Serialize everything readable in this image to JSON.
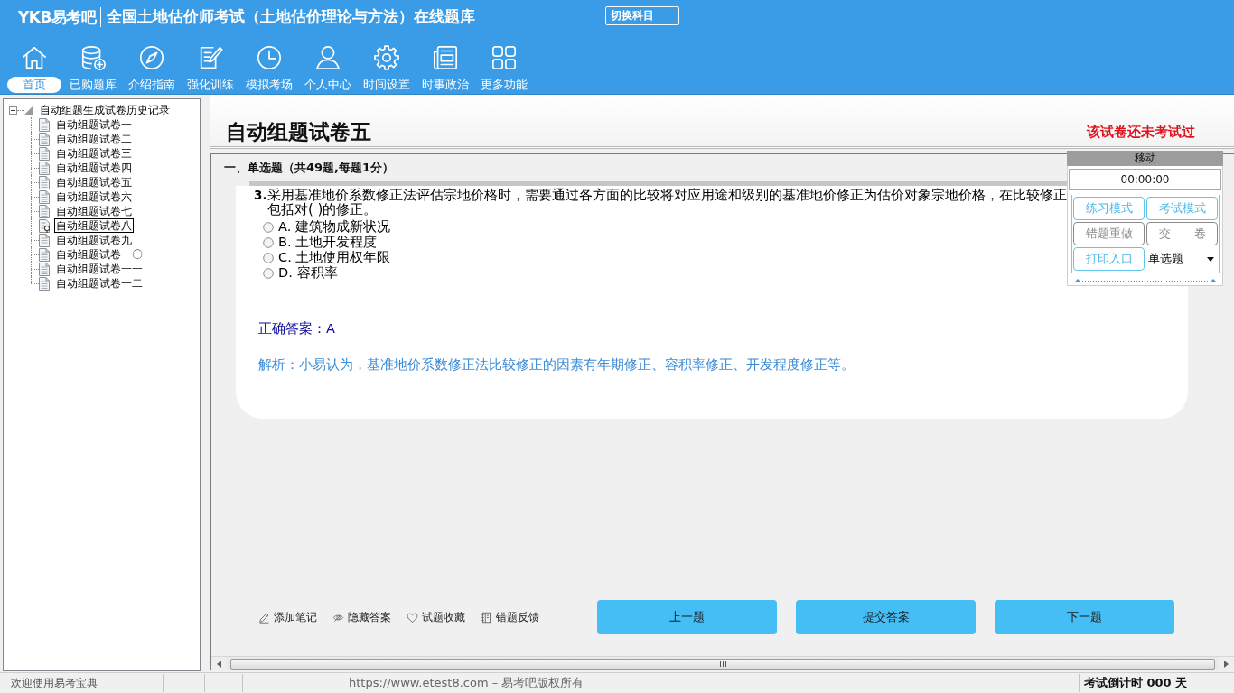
{
  "header": {
    "logo": "YKB易考吧",
    "title": "全国土地估价师考试（土地估价理论与方法）在线题库",
    "switch_button": "切换科目"
  },
  "toolbar": [
    {
      "label": "首页",
      "selected": true
    },
    {
      "label": "已购题库",
      "selected": false
    },
    {
      "label": "介绍指南",
      "selected": false
    },
    {
      "label": "强化训练",
      "selected": false
    },
    {
      "label": "模拟考场",
      "selected": false
    },
    {
      "label": "个人中心",
      "selected": false
    },
    {
      "label": "时间设置",
      "selected": false
    },
    {
      "label": "时事政治",
      "selected": false
    },
    {
      "label": "更多功能",
      "selected": false
    }
  ],
  "tree": {
    "label": "自动组题生成试卷历史记录",
    "expanded": true,
    "children": [
      {
        "label": "自动组题试卷一",
        "selected": false
      },
      {
        "label": "自动组题试卷二",
        "selected": false
      },
      {
        "label": "自动组题试卷三",
        "selected": false
      },
      {
        "label": "自动组题试卷四",
        "selected": false
      },
      {
        "label": "自动组题试卷五",
        "selected": false
      },
      {
        "label": "自动组题试卷六",
        "selected": false
      },
      {
        "label": "自动组题试卷七",
        "selected": false
      },
      {
        "label": "自动组题试卷八",
        "selected": true
      },
      {
        "label": "自动组题试卷九",
        "selected": false
      },
      {
        "label": "自动组题试卷一〇",
        "selected": false
      },
      {
        "label": "自动组题试卷一一",
        "selected": false
      },
      {
        "label": "自动组题试卷一二",
        "selected": false
      }
    ]
  },
  "paper": {
    "title": "自动组题试卷五",
    "status": "该试卷还未考试过"
  },
  "section": {
    "heading": "一、单选题（共49题,每题1分）"
  },
  "question": {
    "number": "3.",
    "text": "采用基准地价系数修正法评估宗地价格时，需要通过各方面的比较将对应用途和级别的基准地价修正为估价对象宗地价格，在比较修正包括对( )的修正。",
    "options": [
      {
        "text": "A. 建筑物成新状况",
        "selected": false
      },
      {
        "text": "B. 土地开发程度",
        "selected": false
      },
      {
        "text": "C. 土地使用权年限",
        "selected": false
      },
      {
        "text": "D. 容积率",
        "selected": false
      }
    ],
    "answer": "正确答案：A",
    "analysis": "解析：小易认为，基准地价系数修正法比较修正的因素有年期修正、容积率修正、开发程度修正等。"
  },
  "control_panel": {
    "title": "移动",
    "timer": "00:00:00",
    "buttons": [
      {
        "label": "练习模式",
        "disabled": false
      },
      {
        "label": "考试模式",
        "disabled": false
      },
      {
        "label": "错题重做",
        "disabled": true
      },
      {
        "label": "交　　卷",
        "disabled": true
      },
      {
        "label": "打印入口",
        "disabled": false
      }
    ],
    "question_type": "单选题"
  },
  "actions": [
    "添加笔记",
    "隐藏答案",
    "试题收藏",
    "错题反馈"
  ],
  "nav_buttons": [
    "上一题",
    "提交答案",
    "下一题"
  ],
  "status_bar": {
    "welcome": "欢迎使用易考宝典",
    "site": "https://www.etest8.com – 易考吧版权所有",
    "countdown": "考试倒计时 000 天"
  }
}
